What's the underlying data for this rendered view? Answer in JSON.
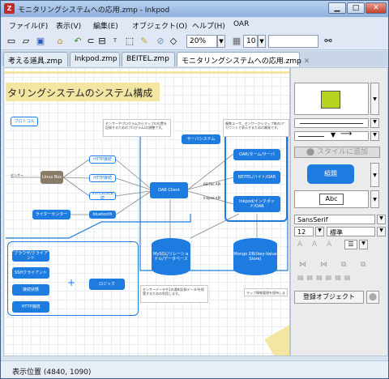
{
  "window": {
    "title": "モニタリングシステムへの応用.zmp - Inkpod",
    "app_icon": "Z",
    "minimize": "▁",
    "maximize": "□",
    "close": "✕"
  },
  "menu": [
    "ファイル(F)",
    "表示(V)",
    "編集(E)",
    "オブジェクト(O)",
    "ヘルプ(H)",
    "OAR"
  ],
  "toolbar": {
    "zoom": "20%",
    "grid": "10"
  },
  "tabs": [
    "考える道具.zmp",
    "Inkpod.zmp",
    "BEITEL.zmp",
    "モニタリングシステムへの応用.zmp"
  ],
  "diagram": {
    "title": "タリングシステムのシステム構成",
    "nodes": [
      "ブロトコル",
      "HTTP接続",
      "HTTP接続",
      "SSH/具体接続",
      "Linux Box",
      "センサー",
      "ライターセンター",
      "bluetooth",
      "OAR Client",
      "サーバシステム",
      "OAR/ターム/サーバ",
      "BEITEL/バイト/OAR",
      "Inkpod/インクポッド/OAR",
      "MySQL/リレーショナル/データベース",
      "Mongo DB/(key-Value Store)",
      "ロジック",
      "ブラウザ/クライアント",
      "SSHクライアント",
      "接続状態",
      "HTTP接続",
      "+"
    ],
    "notes": [
      "センサーやプログラムからマップの位置を記録するためのプログラム/の調整です。",
      "複数ユーザ、センサーからマップ毎の/アカウントで表示するための開発です。",
      "センサーデータや1の通知記録データ/を保管するための利用します。",
      "マップ情報管理を保持します。"
    ],
    "labels": [
      "BEITEL API",
      "Inkpod API"
    ]
  },
  "panel": {
    "style_btn": "スタイルに追加",
    "preset_label": "組題",
    "abc": "Abc",
    "font": "SansSerif",
    "size": "12",
    "weight": "標準",
    "reg_btn": "登録オブジェクト",
    "fill_color": "#b5d41f",
    "accent": "#1e7be0"
  },
  "status": "表示位置 (4840, 1090)"
}
